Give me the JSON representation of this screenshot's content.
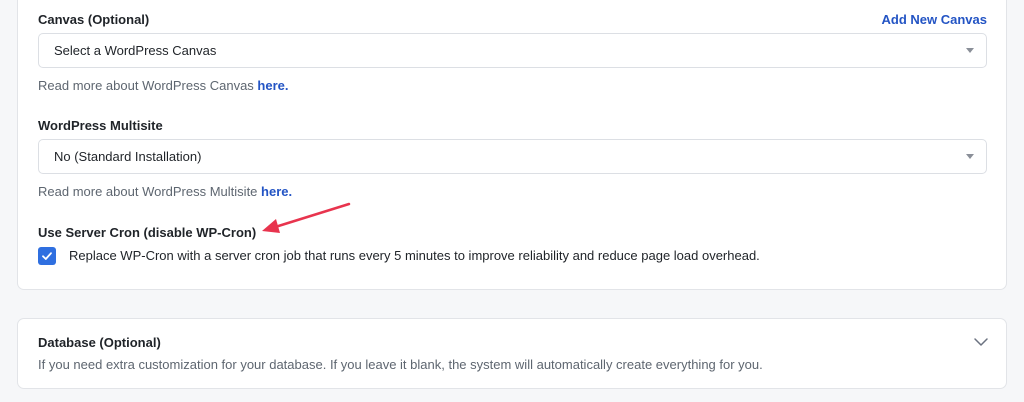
{
  "canvas": {
    "label": "Canvas (Optional)",
    "add_link": "Add New Canvas",
    "select_value": "Select a WordPress Canvas",
    "help_text": "Read more about WordPress Canvas ",
    "help_link": "here."
  },
  "multisite": {
    "label": "WordPress Multisite",
    "select_value": "No (Standard Installation)",
    "help_text": "Read more about WordPress Multisite ",
    "help_link": "here."
  },
  "cron": {
    "label": "Use Server Cron (disable WP-Cron)",
    "checked": true,
    "checkbox_label": "Replace WP-Cron with a server cron job that runs every 5 minutes to improve reliability and reduce page load overhead."
  },
  "database": {
    "title": "Database (Optional)",
    "description": "If you need extra customization for your database. If you leave it blank, the system will automatically create everything for you."
  },
  "colors": {
    "accent": "#2f6fe0",
    "link": "#2354c4",
    "annotation_arrow": "#e8344e"
  }
}
